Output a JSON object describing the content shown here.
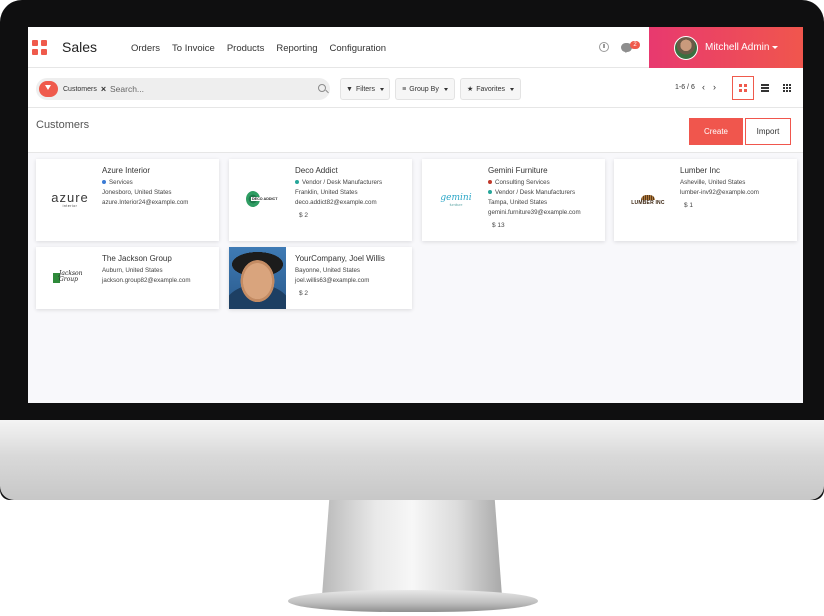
{
  "app": {
    "name": "Sales"
  },
  "menu": [
    "Orders",
    "To Invoice",
    "Products",
    "Reporting",
    "Configuration"
  ],
  "systray": {
    "chat_badge": "2",
    "user_name": "Mitchell Admin"
  },
  "search": {
    "facet": "Customers",
    "placeholder": "Search..."
  },
  "controls": {
    "filters": "Filters",
    "group_by": "Group By",
    "favorites": "Favorites"
  },
  "pager": {
    "value": "1-6 / 6",
    "prev": "‹",
    "next": "›"
  },
  "page": {
    "title": "Customers",
    "create": "Create",
    "import": "Import"
  },
  "colors": {
    "accent": "#ef5a4c",
    "gradient_start": "#e8396f",
    "gradient_end": "#f0564d"
  },
  "customers": [
    {
      "name": "Azure Interior",
      "tag": "Services",
      "tag2": "",
      "location": "Jonesboro, United States",
      "email": "azure.Interior24@example.com",
      "meta": "",
      "logo": "azure-logo",
      "logo_text": "azure",
      "logo_sub": "interior"
    },
    {
      "name": "Deco Addict",
      "tag": "Vendor / Desk Manufacturers",
      "tag2": "",
      "location": "Franklin, United States",
      "email": "deco.addict82@example.com",
      "meta": "$ 2",
      "logo": "deco-addict-logo",
      "logo_text": "DECO ADDICT"
    },
    {
      "name": "Gemini Furniture",
      "tag": "Consulting Services",
      "tag2": "Vendor / Desk Manufacturers",
      "location": "Tampa, United States",
      "email": "gemini.furniture39@example.com",
      "meta": "$ 13",
      "logo": "gemini-logo",
      "logo_text": "gemini",
      "logo_sub": "furniture"
    },
    {
      "name": "Lumber Inc",
      "tag": "",
      "tag2": "",
      "location": "Asheville, United States",
      "email": "lumber-inv92@example.com",
      "meta": "$ 1",
      "logo": "lumber-logo",
      "logo_text": "LUMBER INC"
    },
    {
      "name": "The Jackson Group",
      "tag": "",
      "tag2": "",
      "location": "Auburn, United States",
      "email": "jackson.group82@example.com",
      "meta": "",
      "logo": "jackson-logo",
      "logo_text": "Jackson Group"
    },
    {
      "name": "YourCompany, Joel Willis",
      "tag": "",
      "tag2": "",
      "location": "Bayonne, United States",
      "email": "joel.willis63@example.com",
      "meta": "$ 2",
      "logo": "person-photo"
    }
  ]
}
